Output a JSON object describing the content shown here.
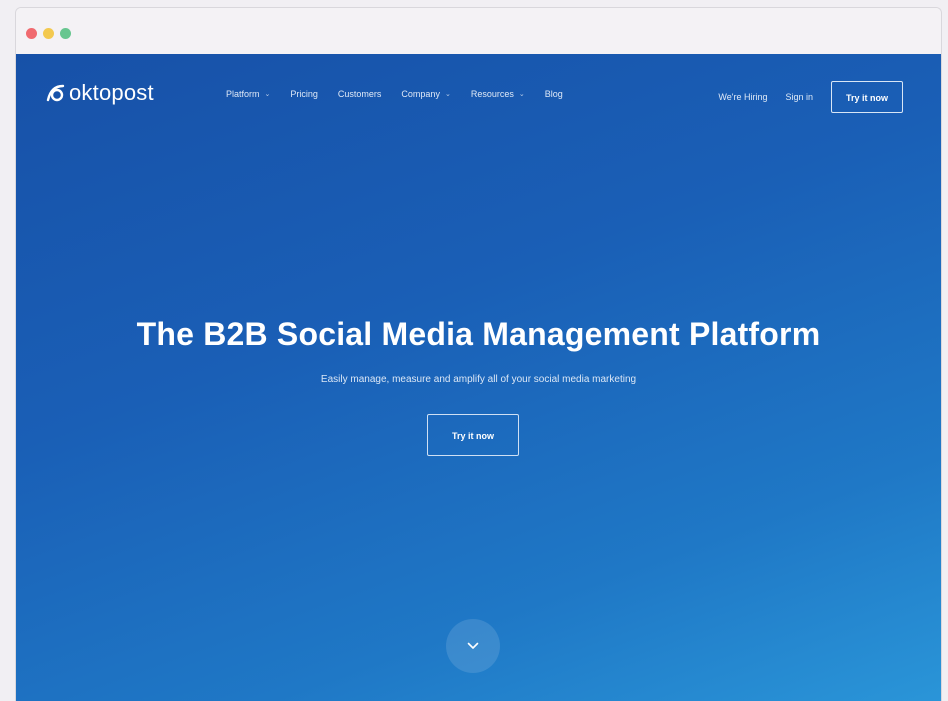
{
  "window": {
    "controls": [
      "close",
      "minimize",
      "maximize"
    ]
  },
  "logo": {
    "text": "oktopost",
    "icon": "oktopost-logo-icon"
  },
  "nav": {
    "items": [
      {
        "label": "Platform",
        "has_dropdown": true
      },
      {
        "label": "Pricing",
        "has_dropdown": false
      },
      {
        "label": "Customers",
        "has_dropdown": false
      },
      {
        "label": "Company",
        "has_dropdown": true
      },
      {
        "label": "Resources",
        "has_dropdown": true
      },
      {
        "label": "Blog",
        "has_dropdown": false
      }
    ],
    "caret": "⌄",
    "hiring": "We're Hiring",
    "sign_in": "Sign in",
    "try_now": "Try it now"
  },
  "hero": {
    "title": "The B2B Social Media Management Platform",
    "subtitle": "Easily manage, measure and amplify all of your social media marketing",
    "cta": "Try it now",
    "scroll_icon": "chevron-down-icon"
  },
  "colors": {
    "gradient_start": "#1751a8",
    "gradient_end": "#2a95d8",
    "text": "#ffffff",
    "close": "#f06a6f",
    "minimize": "#f3c94f",
    "maximize": "#67c68f"
  }
}
